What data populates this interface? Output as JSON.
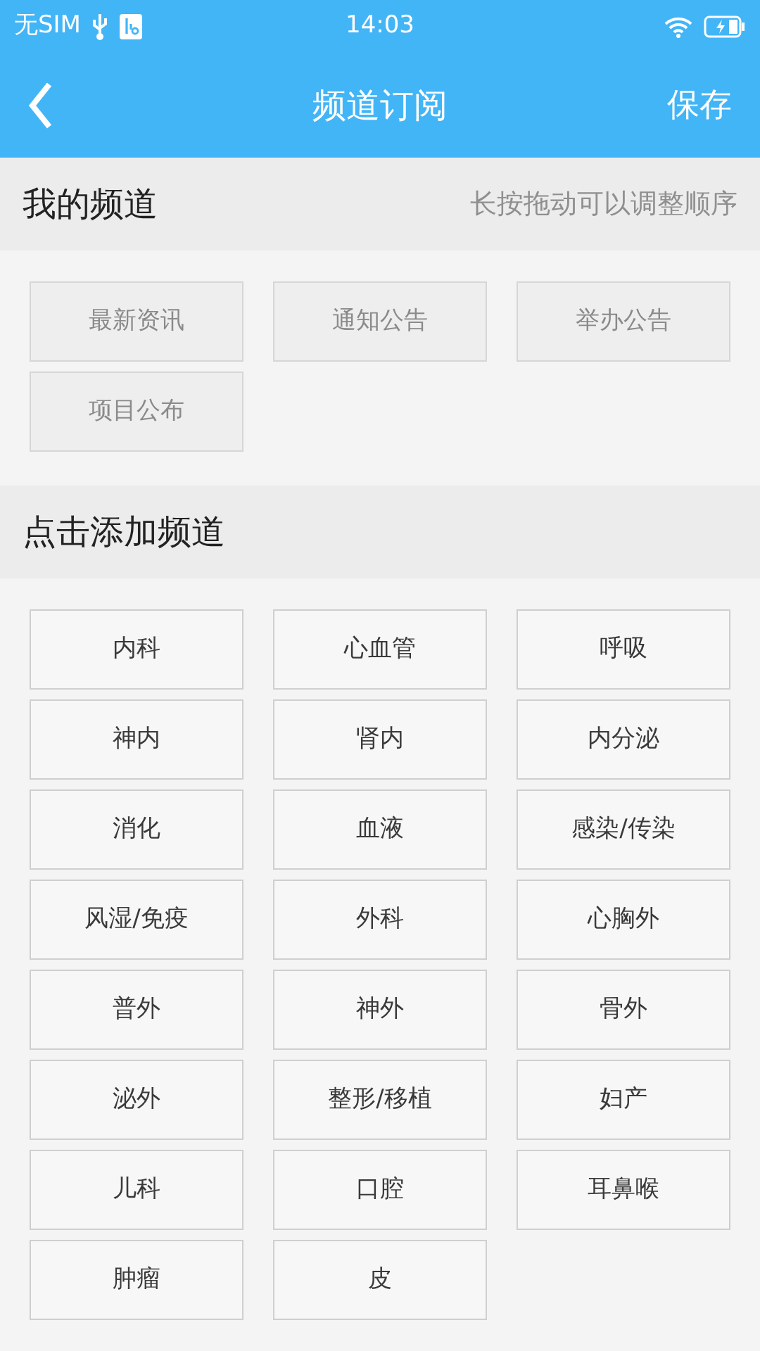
{
  "status_bar": {
    "carrier": "无SIM",
    "time": "14:03"
  },
  "header": {
    "title": "频道订阅",
    "action": "保存"
  },
  "my_channels": {
    "title": "我的频道",
    "hint": "长按拖动可以调整顺序",
    "items": [
      "最新资讯",
      "通知公告",
      "举办公告",
      "项目公布"
    ]
  },
  "add_channels": {
    "title": "点击添加频道",
    "items": [
      "内科",
      "心血管",
      "呼吸",
      "神内",
      "肾内",
      "内分泌",
      "消化",
      "血液",
      "感染/传染",
      "风湿/免疫",
      "外科",
      "心胸外",
      "普外",
      "神外",
      "骨外",
      "泌外",
      "整形/移植",
      "妇产",
      "儿科",
      "口腔",
      "耳鼻喉",
      "肿瘤",
      "皮"
    ]
  }
}
